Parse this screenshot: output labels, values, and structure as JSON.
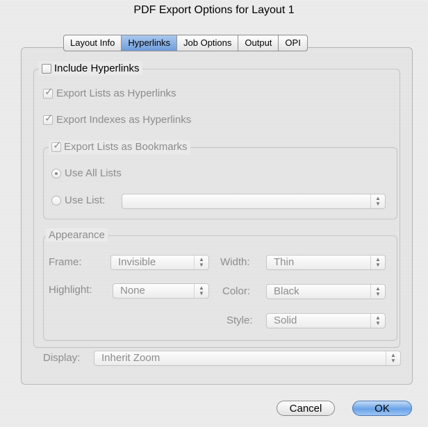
{
  "window": {
    "title": "PDF Export Options for Layout 1"
  },
  "tabs": [
    {
      "label": "Layout Info"
    },
    {
      "label": "Hyperlinks",
      "active": true
    },
    {
      "label": "Job Options"
    },
    {
      "label": "Output"
    },
    {
      "label": "OPI"
    }
  ],
  "hyperlinks": {
    "include_label": "Include Hyperlinks",
    "include_checked": false,
    "export_lists_label": "Export Lists as Hyperlinks",
    "export_lists_checked": true,
    "export_indexes_label": "Export Indexes as Hyperlinks",
    "export_indexes_checked": true,
    "bookmarks": {
      "label": "Export Lists as Bookmarks",
      "checked": true,
      "use_all_label": "Use All Lists",
      "use_list_label": "Use List:",
      "use_list_value": "",
      "selected_option": "Use All Lists"
    },
    "appearance": {
      "label": "Appearance",
      "frame_label": "Frame:",
      "frame_value": "Invisible",
      "width_label": "Width:",
      "width_value": "Thin",
      "highlight_label": "Highlight:",
      "highlight_value": "None",
      "color_label": "Color:",
      "color_value": "Black",
      "style_label": "Style:",
      "style_value": "Solid"
    },
    "display_label": "Display:",
    "display_value": "Inherit Zoom"
  },
  "buttons": {
    "cancel": "Cancel",
    "ok": "OK"
  },
  "colors": {
    "tab_active": "#6f9ddb",
    "disabled_text": "#8c8c8c",
    "ok_button": "#6aa3e8"
  }
}
